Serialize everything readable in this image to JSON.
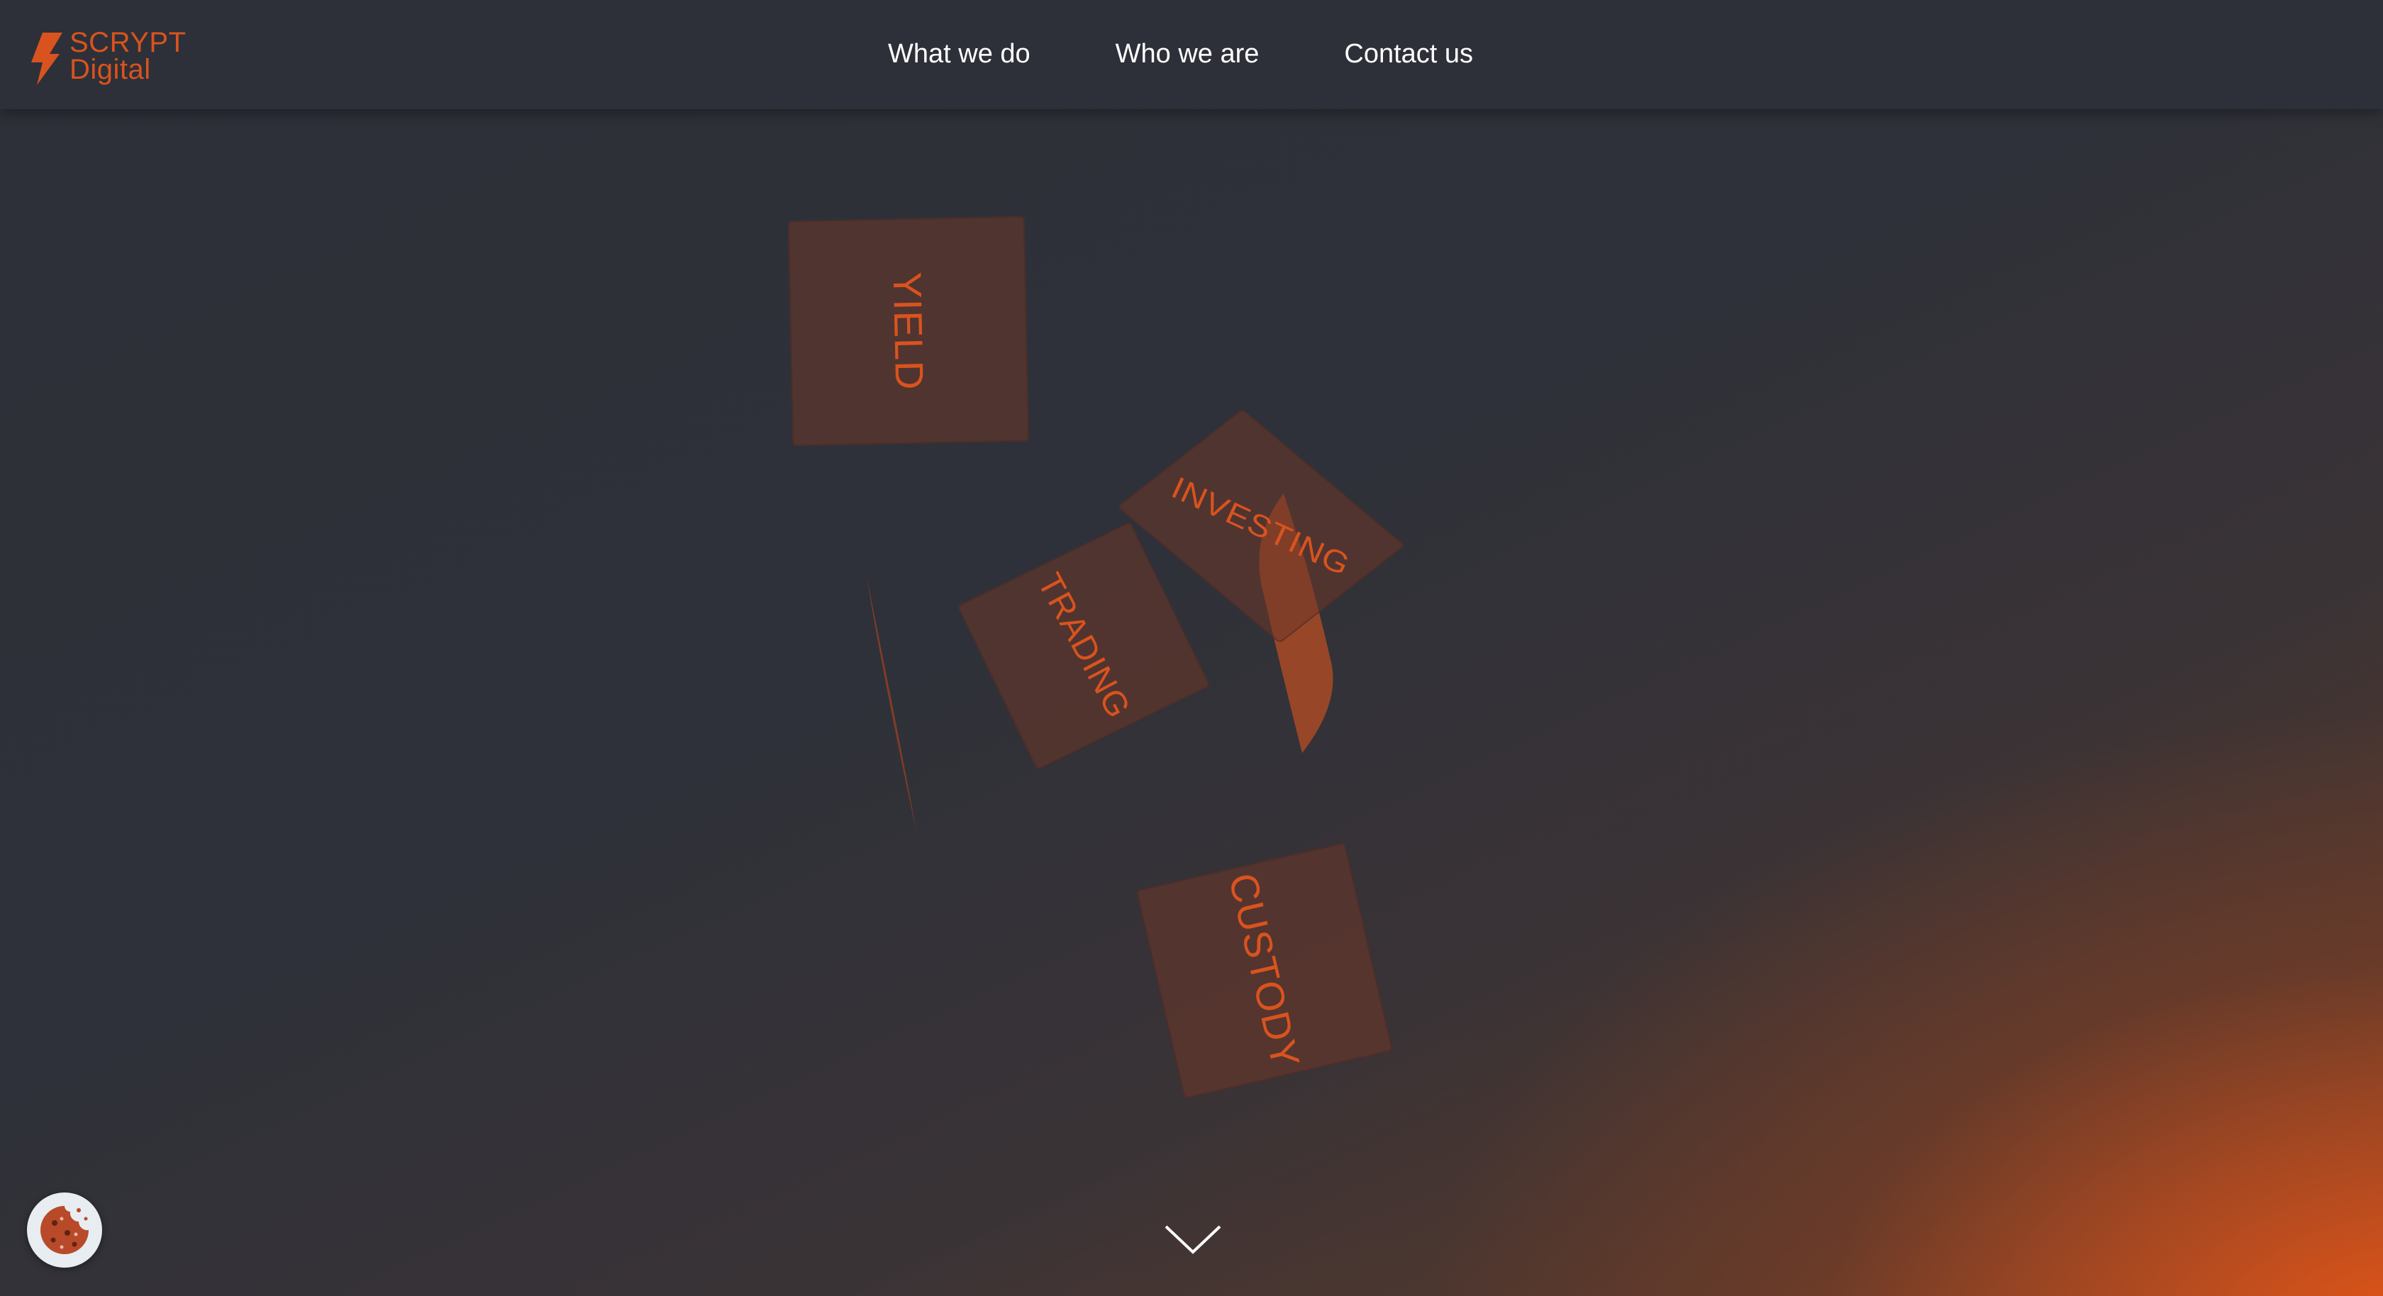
{
  "header": {
    "logo": {
      "line1": "SCRYPT",
      "line2": "Digital",
      "icon": "lightning-bolt-logo-icon"
    },
    "nav": [
      {
        "label": "What we do"
      },
      {
        "label": "Who we are"
      },
      {
        "label": "Contact us"
      }
    ]
  },
  "hero": {
    "cards": [
      {
        "label": "YIELD"
      },
      {
        "label": "INVESTING"
      },
      {
        "label": "TRADING"
      },
      {
        "label": "CUSTODY"
      }
    ],
    "scroll_icon": "chevron-down-icon"
  },
  "cookie_widget": {
    "icon": "cookie-icon"
  },
  "colors": {
    "background": "#2d3038",
    "accent": "#d9531e",
    "nav_text": "#ffffff",
    "card_fill": "#6e3728"
  }
}
